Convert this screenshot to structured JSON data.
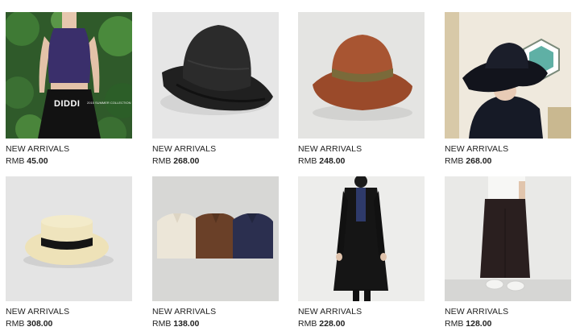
{
  "products": [
    {
      "label": "NEW ARRIVALS",
      "currency": "RMB",
      "price": "45.00",
      "image_icon": "sleeveless-top-photo",
      "brand": "DIDDI",
      "brand_sub": "2015 SUMMER COLLECTION"
    },
    {
      "label": "NEW ARRIVALS",
      "currency": "RMB",
      "price": "268.00",
      "image_icon": "black-bucket-hat-photo"
    },
    {
      "label": "NEW ARRIVALS",
      "currency": "RMB",
      "price": "248.00",
      "image_icon": "rust-bucket-hat-photo"
    },
    {
      "label": "NEW ARRIVALS",
      "currency": "RMB",
      "price": "268.00",
      "image_icon": "model-wide-brim-hat-photo"
    },
    {
      "label": "NEW ARRIVALS",
      "currency": "RMB",
      "price": "308.00",
      "image_icon": "straw-boater-hat-photo"
    },
    {
      "label": "NEW ARRIVALS",
      "currency": "RMB",
      "price": "138.00",
      "image_icon": "folded-shirts-photo"
    },
    {
      "label": "NEW ARRIVALS",
      "currency": "RMB",
      "price": "228.00",
      "image_icon": "black-coat-outfit-photo"
    },
    {
      "label": "NEW ARRIVALS",
      "currency": "RMB",
      "price": "128.00",
      "image_icon": "wide-leg-pants-photo"
    }
  ]
}
